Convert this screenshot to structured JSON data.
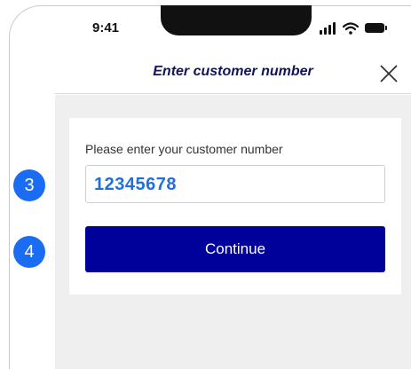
{
  "status_bar": {
    "time": "9:41",
    "icons": [
      "signal-icon",
      "wifi-icon",
      "battery-icon"
    ]
  },
  "header": {
    "title": "Enter customer number",
    "close_icon": "close-icon"
  },
  "form": {
    "label": "Please enter your customer number",
    "customer_number_value": "12345678",
    "continue_label": "Continue"
  },
  "annotations": {
    "step_3": "3",
    "step_4": "4"
  },
  "colors": {
    "primary_button": "#00009a",
    "input_value_text": "#1f6fe0",
    "step_badge": "#1a6cf2",
    "title_text": "#14145a",
    "page_background": "#efefef"
  }
}
